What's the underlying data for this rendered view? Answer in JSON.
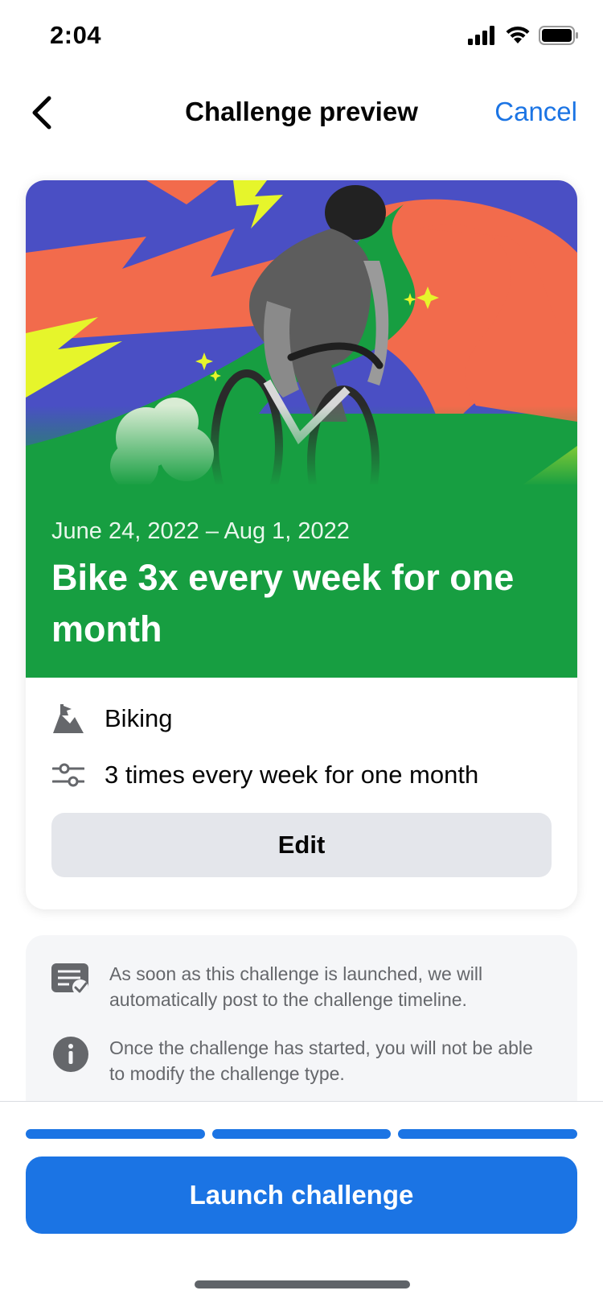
{
  "status_bar": {
    "time": "2:04",
    "icons": [
      "signal-icon",
      "wifi-icon",
      "battery-icon"
    ]
  },
  "nav": {
    "back_icon": "chevron-left-icon",
    "title": "Challenge preview",
    "cancel_label": "Cancel"
  },
  "challenge": {
    "date_range": "June 24, 2022 – Aug 1, 2022",
    "title": "Bike 3x every week for one month",
    "activity": {
      "icon": "mountain-flag-icon",
      "label": "Biking"
    },
    "frequency": {
      "icon": "sliders-icon",
      "label": "3 times every week for one month"
    },
    "edit_label": "Edit"
  },
  "info": [
    {
      "icon": "post-check-icon",
      "text": "As soon as this challenge is launched, we will automatically post to the challenge timeline."
    },
    {
      "icon": "info-icon",
      "text": "Once the challenge has started, you will not be able to modify the challenge type."
    }
  ],
  "footer": {
    "progress_steps": 3,
    "completed_steps": 3,
    "launch_label": "Launch challenge"
  },
  "colors": {
    "accent": "#1b74e4",
    "hero_green": "#179e41",
    "hero_red": "#f26b4c",
    "hero_blue": "#4a4fc4",
    "hero_yellow": "#e6f52b"
  }
}
